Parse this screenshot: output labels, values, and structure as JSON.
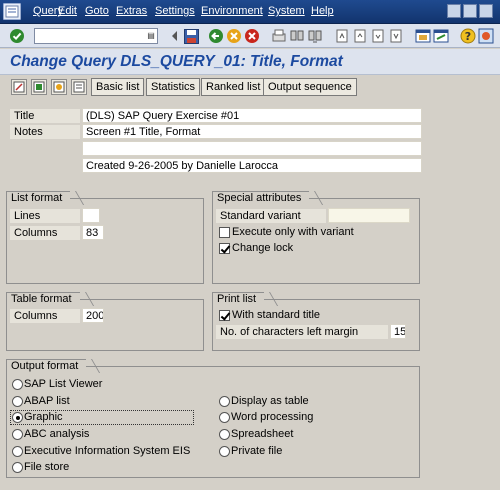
{
  "menubar": {
    "items": [
      "Query",
      "Edit",
      "Goto",
      "Extras",
      "Settings",
      "Environment",
      "System",
      "Help"
    ]
  },
  "toolbar": {
    "command_field_value": "",
    "icons": [
      "enter-icon",
      "back-icon",
      "save-icon",
      "exit-icon",
      "cancel-icon",
      "print-icon",
      "find-icon",
      "find-next-icon",
      "first-page-icon",
      "previous-page-icon",
      "next-page-icon",
      "last-page-icon",
      "create-session-icon",
      "shortcut-icon",
      "help-icon",
      "layout-icon"
    ]
  },
  "page": {
    "title": "Change Query DLS_QUERY_01: Title, Format"
  },
  "app_toolbar": {
    "buttons": [
      "Basic list",
      "Statistics",
      "Ranked list",
      "Output sequence"
    ]
  },
  "header": {
    "title_label": "Title",
    "title_value": "(DLS) SAP Query Exercise #01",
    "notes_label": "Notes",
    "notes_lines": [
      "Screen #1 Title, Format",
      "",
      "Created 9-26-2005 by Danielle Larocca"
    ]
  },
  "list_format": {
    "group_title": "List format",
    "lines_label": "Lines",
    "lines_value": "",
    "columns_label": "Columns",
    "columns_value": "83"
  },
  "special_attributes": {
    "group_title": "Special attributes",
    "standard_variant_label": "Standard variant",
    "standard_variant_value": "",
    "execute_only_label": "Execute only with variant",
    "execute_only_checked": false,
    "change_lock_label": "Change lock",
    "change_lock_checked": true
  },
  "table_format": {
    "group_title": "Table format",
    "columns_label": "Columns",
    "columns_value": "200"
  },
  "print_list": {
    "group_title": "Print list",
    "standard_title_label": "With standard title",
    "standard_title_checked": true,
    "left_margin_label": "No. of characters left margin",
    "left_margin_value": "15"
  },
  "output_format": {
    "group_title": "Output format",
    "left_options": [
      "SAP List Viewer",
      "ABAP list",
      "Graphic",
      "ABC analysis",
      "Executive Information System EIS",
      "File store"
    ],
    "right_options": [
      "Display as table",
      "Word processing",
      "Spreadsheet",
      "Private file"
    ],
    "selected": "Graphic"
  },
  "colors": {
    "menubar_bg": "#1f4a8f",
    "title_text": "#1c4aa0",
    "screen_bg": "#d4d0c8"
  }
}
